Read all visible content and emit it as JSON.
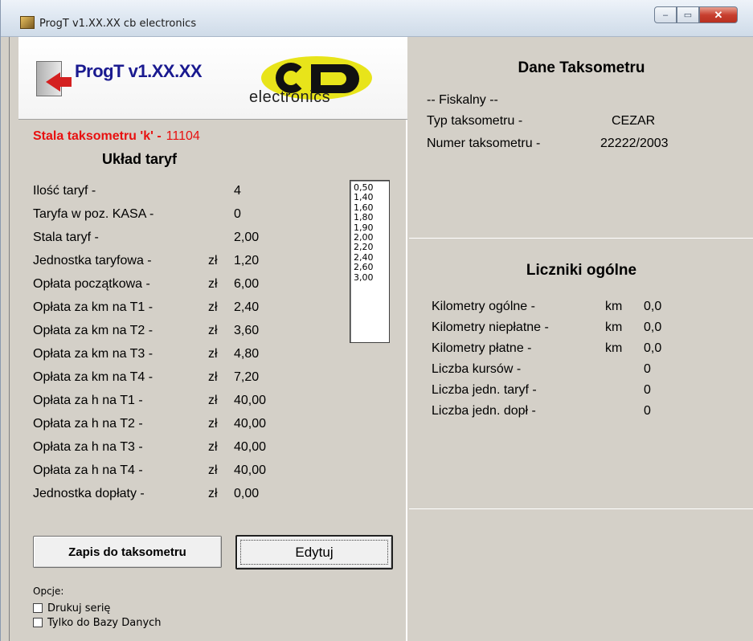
{
  "window": {
    "title": "ProgT v1.XX.XX  cb electronics",
    "controls": {
      "minimize": "–",
      "maximize": "▭",
      "close": "✕"
    }
  },
  "logo": {
    "title": "ProgT v1.XX.XX",
    "brand_sub": "electronics",
    "brand_color": "#e8e41a"
  },
  "stala_k": {
    "label": "Stala taksometru 'k' -",
    "value": "11104",
    "color": "#e81010"
  },
  "tariffs": {
    "title": "Układ taryf",
    "rows": [
      {
        "label": "Ilość taryf -",
        "currency": "",
        "value": "4"
      },
      {
        "label": "Taryfa w poz. KASA -",
        "currency": "",
        "value": "0"
      },
      {
        "label": "Stala taryf -",
        "currency": "",
        "value": "2,00"
      },
      {
        "label": "Jednostka taryfowa -",
        "currency": "zł",
        "value": "1,20"
      },
      {
        "label": "Opłata początkowa -",
        "currency": "zł",
        "value": "6,00"
      },
      {
        "label": "Opłata za km na T1 -",
        "currency": "zł",
        "value": "2,40"
      },
      {
        "label": "Opłata za km na T2 -",
        "currency": "zł",
        "value": "3,60"
      },
      {
        "label": "Opłata za km na T3 -",
        "currency": "zł",
        "value": "4,80"
      },
      {
        "label": "Opłata za km na T4 -",
        "currency": "zł",
        "value": "7,20"
      },
      {
        "label": "Opłata za h na T1 -",
        "currency": "zł",
        "value": "40,00"
      },
      {
        "label": "Opłata za h na T2 -",
        "currency": "zł",
        "value": "40,00"
      },
      {
        "label": "Opłata za h na T3 -",
        "currency": "zł",
        "value": "40,00"
      },
      {
        "label": "Opłata za h na T4 -",
        "currency": "zł",
        "value": "40,00"
      },
      {
        "label": "Jednostka dopłaty -",
        "currency": "zł",
        "value": "0,00"
      }
    ],
    "rate_list": [
      "0,50",
      "1,40",
      "1,60",
      "1,80",
      "1,90",
      "2,00",
      "2,20",
      "2,40",
      "2,60",
      "3,00"
    ]
  },
  "buttons": {
    "save": "Zapis do taksometru",
    "edit": "Edytuj"
  },
  "options": {
    "label": "Opcje:",
    "items": [
      {
        "label": "Drukuj serię",
        "checked": false
      },
      {
        "label": "Tylko do Bazy Danych",
        "checked": false
      }
    ]
  },
  "taximeter": {
    "title": "Dane Taksometru",
    "fiscal": "-- Fiskalny --",
    "type_label": "Typ taksometru -",
    "type_value": "CEZAR",
    "number_label": "Numer taksometru -",
    "number_value": "22222/2003"
  },
  "counters": {
    "title": "Liczniki ogólne",
    "rows": [
      {
        "label": "Kilometry ogólne -",
        "unit": "km",
        "value": "0,0"
      },
      {
        "label": "Kilometry niepłatne -",
        "unit": "km",
        "value": "0,0"
      },
      {
        "label": "Kilometry płatne -",
        "unit": "km",
        "value": "0,0"
      },
      {
        "label": "Liczba kursów -",
        "unit": "",
        "value": "0"
      },
      {
        "label": "Liczba jedn. taryf -",
        "unit": "",
        "value": "0"
      },
      {
        "label": "Liczba jedn. dopł -",
        "unit": "",
        "value": "0"
      }
    ]
  }
}
